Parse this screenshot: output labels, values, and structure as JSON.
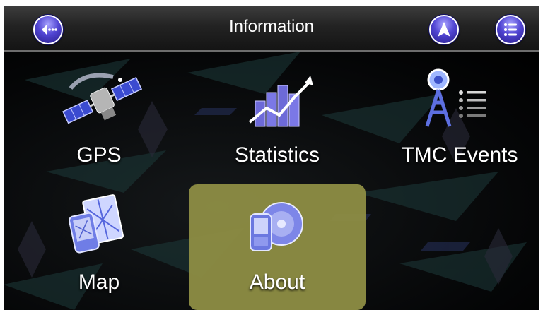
{
  "header": {
    "title": "Information",
    "back_icon": "back-arrow-icon",
    "navigate_icon": "navigation-arrow-icon",
    "menu_icon": "menu-list-icon"
  },
  "menu": {
    "items": [
      {
        "label": "GPS",
        "icon": "satellite-icon"
      },
      {
        "label": "Statistics",
        "icon": "statistics-chart-icon"
      },
      {
        "label": "TMC Events",
        "icon": "tmc-tower-icon"
      },
      {
        "label": "Map",
        "icon": "map-icon"
      },
      {
        "label": "About",
        "icon": "about-disc-icon",
        "selected": true
      }
    ]
  },
  "colors": {
    "accent_button": "#5145d3",
    "selected_tile": "#8d8c44",
    "header_bg": "#232323"
  }
}
